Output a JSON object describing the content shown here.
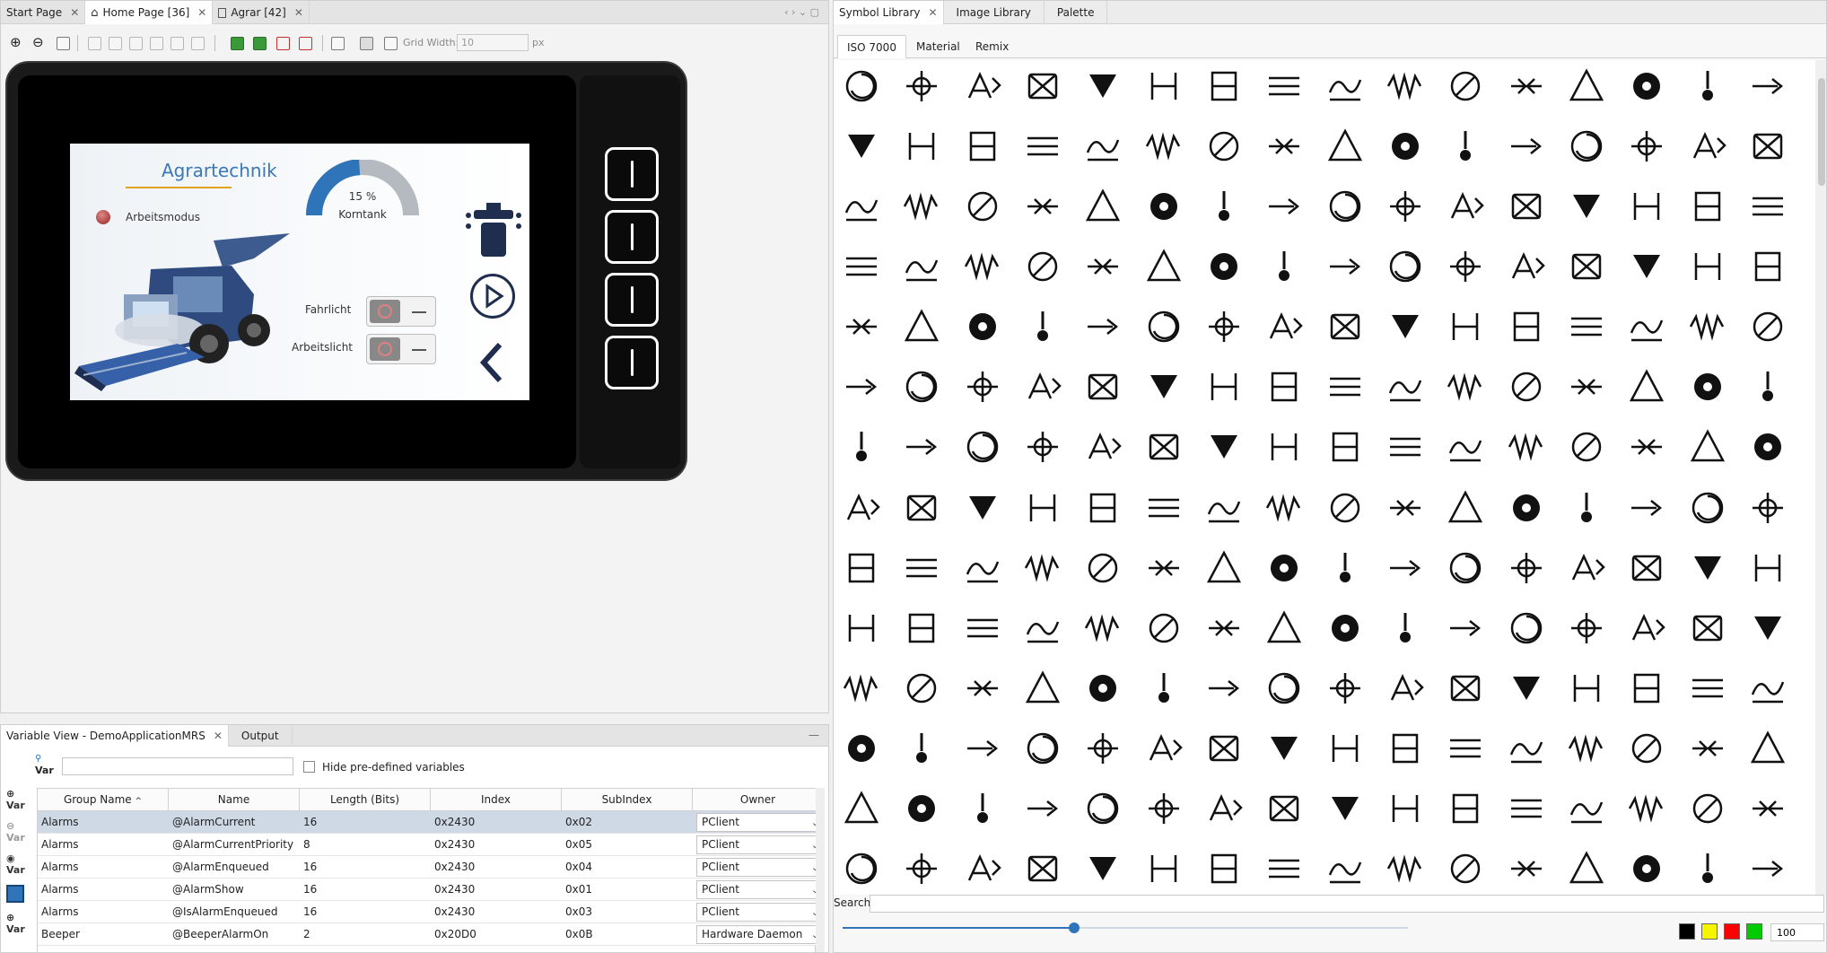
{
  "editor": {
    "tabs": [
      {
        "label": "Start Page",
        "active": false
      },
      {
        "label": "Home Page [36]",
        "active": true
      },
      {
        "label": "Agrar [42]",
        "active": false
      }
    ],
    "toolbar": {
      "grid_label": "Grid Width:",
      "grid_value": "10",
      "grid_unit": "px"
    },
    "screen": {
      "title": "Agrartechnik",
      "mode_label": "Arbeitsmodus",
      "gauge_value": "15",
      "gauge_unit": "%",
      "gauge_fraction": 0.15,
      "gauge_label": "Korntank",
      "toggle1_label": "Fahrlicht",
      "toggle2_label": "Arbeitslicht"
    }
  },
  "bottom": {
    "tabs": [
      {
        "label": "Variable View - DemoApplicationMRS",
        "active": true
      },
      {
        "label": "Output",
        "active": false
      }
    ],
    "var_label": "Var",
    "search_value": "",
    "hide_label": "Hide pre-defined variables",
    "columns": [
      "Group Name",
      "Name",
      "Length (Bits)",
      "Index",
      "SubIndex",
      "Owner"
    ],
    "rows": [
      {
        "group": "Alarms",
        "name": "@AlarmCurrent",
        "length": "16",
        "index": "0x2430",
        "sub": "0x02",
        "owner": "PClient",
        "selected": true
      },
      {
        "group": "Alarms",
        "name": "@AlarmCurrentPriority",
        "length": "8",
        "index": "0x2430",
        "sub": "0x05",
        "owner": "PClient",
        "selected": false
      },
      {
        "group": "Alarms",
        "name": "@AlarmEnqueued",
        "length": "16",
        "index": "0x2430",
        "sub": "0x04",
        "owner": "PClient",
        "selected": false
      },
      {
        "group": "Alarms",
        "name": "@AlarmShow",
        "length": "16",
        "index": "0x2430",
        "sub": "0x01",
        "owner": "PClient",
        "selected": false
      },
      {
        "group": "Alarms",
        "name": "@IsAlarmEnqueued",
        "length": "16",
        "index": "0x2430",
        "sub": "0x03",
        "owner": "PClient",
        "selected": false
      },
      {
        "group": "Beeper",
        "name": "@BeeperAlarmOn",
        "length": "2",
        "index": "0x20D0",
        "sub": "0x0B",
        "owner": "Hardware Daemon",
        "selected": false
      }
    ]
  },
  "library": {
    "tabs": [
      {
        "label": "Symbol Library",
        "active": true
      },
      {
        "label": "Image Library",
        "active": false
      },
      {
        "label": "Palette",
        "active": false
      }
    ],
    "subtabs": [
      {
        "label": "ISO 7000",
        "active": true
      },
      {
        "label": "Material",
        "active": false
      },
      {
        "label": "Remix",
        "active": false
      }
    ],
    "search_label": "Search",
    "search_value": "",
    "size_value": "100",
    "slider_fraction": 0.41,
    "swatches": [
      "#000000",
      "#f5f500",
      "#ff0000",
      "#00cc00"
    ]
  }
}
